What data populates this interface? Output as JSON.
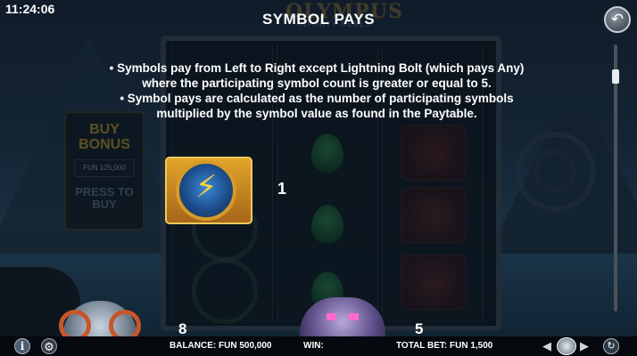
{
  "status": {
    "clock": "11:24:06"
  },
  "background": {
    "logo_title": "OLYMPUS",
    "logo_subtitle": "INFINITY REELS",
    "buy_bonus_label": "BUY BONUS",
    "buy_bonus_price": "FUN 125,000",
    "press_to_buy_label": "PRESS TO BUY"
  },
  "info_page": {
    "title": "SYMBOL PAYS",
    "rules": [
      "• Symbols pay from Left to Right except Lightning Bolt (which pays Any)",
      "where the participating symbol count is greater or equal to 5.",
      "• Symbol pays are calculated as the number of participating symbols",
      "multiplied by the symbol value as found in the Paytable."
    ],
    "symbols": [
      {
        "icon": "lightning-bolt-icon",
        "pay": "1"
      },
      {
        "icon": "ram-icon",
        "pay": "8"
      },
      {
        "icon": "wolf-icon",
        "pay": "5"
      }
    ],
    "scroll_fraction": 0.1
  },
  "controls": {
    "back_glyph": "↶"
  },
  "bottom_bar": {
    "balance": "BALANCE: FUN 500,000",
    "win": "WIN:",
    "total_bet": "TOTAL BET: FUN 1,500",
    "info_glyph": "i",
    "gear_glyph": "⚙",
    "autoplay_glyph": "↻",
    "bet_left_glyph": "◀",
    "bet_right_glyph": "▶"
  },
  "colors": {
    "accent_gold": "#d2a52a",
    "background": "#0b1522",
    "bottom_bar": "#06090d"
  }
}
